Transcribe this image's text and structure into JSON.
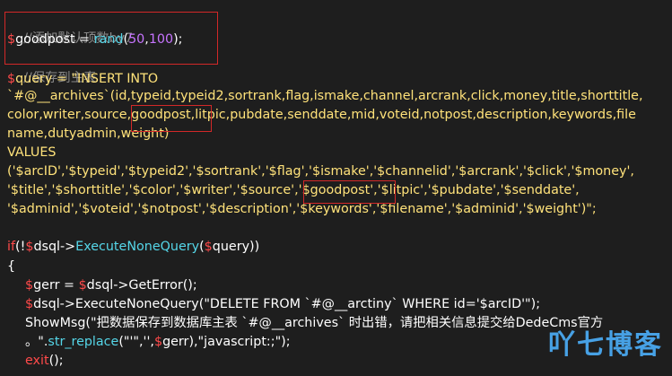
{
  "code": {
    "l1_comment": "//添加默认顶数by7",
    "l2_var": "$",
    "l2_name": "goodpost = ",
    "l2_func": "rand",
    "l2_p1": "(",
    "l2_n1": "50",
    "l2_c": ",",
    "l2_n2": "100",
    "l2_p2": ");",
    "l3_comment": "//保存到主表",
    "l4_var": "$",
    "l4_text": "query = \"INSERT INTO",
    "l5_text": "`#@__archives`(id,typeid,typeid2,sortrank,flag,ismake,channel,arcrank,click,money,title,shorttitle,",
    "l6_text": "color,writer,source,goodpost,litpic,pubdate,senddate,mid,voteid,notpost,description,keywords,file",
    "l7_text": "name,dutyadmin,weight)",
    "l8_text": "VALUES",
    "l9_text": "('$arcID','$typeid','$typeid2','$sortrank','$flag','$ismake','$channelid','$arcrank','$click','$money',",
    "l10_text": "'$title','$shorttitle','$color','$writer','$source','$goodpost','$litpic','$pubdate','$senddate',",
    "l11_text": "'$adminid','$voteid','$notpost','$description','$keywords','$filename','$adminid','$weight')\";",
    "l13_kw": "if",
    "l13_a": "(!",
    "l13_var": "$",
    "l13_b": "dsql->",
    "l13_func": "ExecuteNoneQuery",
    "l13_c": "(",
    "l13_var2": "$",
    "l13_d": "query))",
    "l14_text": "{",
    "l15_var": "$",
    "l15_a": "gerr = ",
    "l15_var2": "$",
    "l15_b": "dsql->GetError();",
    "l16_var": "$",
    "l16_a": "dsql->ExecuteNoneQuery(\"DELETE FROM `#@__arctiny` WHERE id='$arcID'\");",
    "l17_text": "ShowMsg(\"把数据保存到数据库主表 `#@__archives` 时出错，请把相关信息提交给DedeCms官方",
    "l18_a": "。\".",
    "l18_func": "str_replace",
    "l18_b": "(\"'\",'',",
    "l18_var": "$",
    "l18_c": "gerr),\"javascript:;\");",
    "l19_kw": "exit",
    "l19_a": "();"
  },
  "watermark": "吖七博客"
}
